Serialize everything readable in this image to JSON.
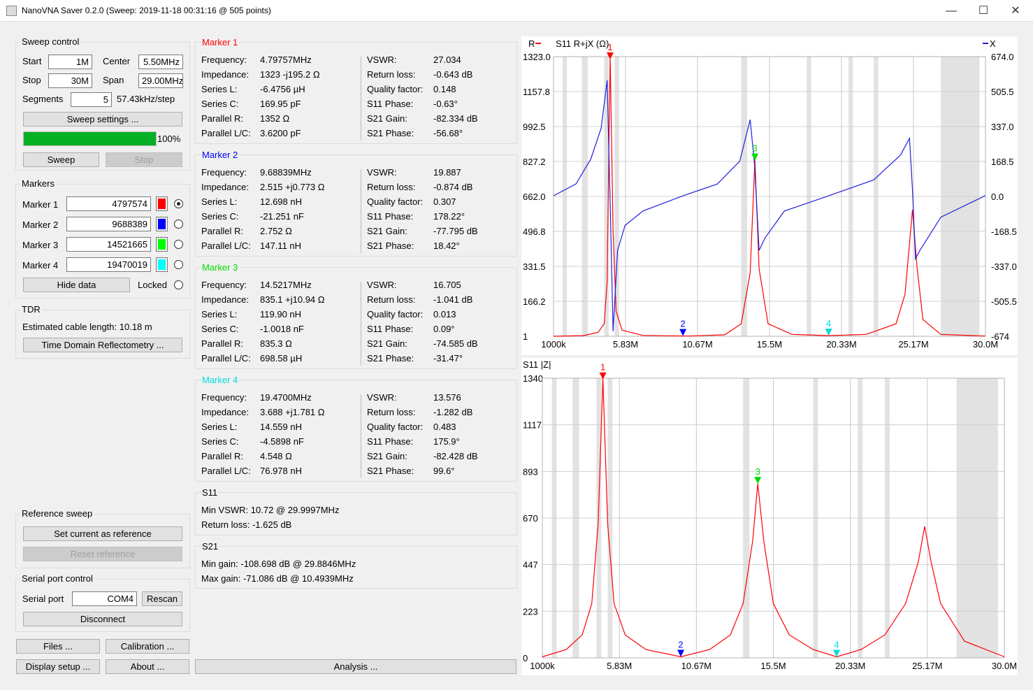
{
  "window": {
    "title": "NanoVNA Saver 0.2.0 (Sweep: 2019-11-18 00:31:16 @ 505 points)",
    "minimize": "—",
    "maximize": "☐",
    "close": "✕"
  },
  "sweep_control": {
    "title": "Sweep control",
    "start_label": "Start",
    "start_value": "1M",
    "center_label": "Center",
    "center_value": "5.50MHz",
    "stop_label": "Stop",
    "stop_value": "30M",
    "span_label": "Span",
    "span_value": "29.00MHz",
    "segments_label": "Segments",
    "segments_value": "5",
    "step_text": "57.43kHz/step",
    "sweep_settings": "Sweep settings ...",
    "progress_text": "100%",
    "progress": 1.0,
    "sweep": "Sweep",
    "stop": "Stop"
  },
  "markers_group": {
    "title": "Markers",
    "items": [
      {
        "label": "Marker 1",
        "value": "4797574",
        "color": "#ff0000",
        "selected": true
      },
      {
        "label": "Marker 2",
        "value": "9688389",
        "color": "#0000ff",
        "selected": false
      },
      {
        "label": "Marker 3",
        "value": "14521665",
        "color": "#00ff00",
        "selected": false
      },
      {
        "label": "Marker 4",
        "value": "19470019",
        "color": "#00ffff",
        "selected": false
      }
    ],
    "hide_data": "Hide data",
    "locked": "Locked"
  },
  "tdr": {
    "title": "TDR",
    "cable_text": "Estimated cable length: 10.18 m",
    "button": "Time Domain Reflectometry ..."
  },
  "reference": {
    "title": "Reference sweep",
    "set": "Set current as reference",
    "reset": "Reset reference"
  },
  "serial": {
    "title": "Serial port control",
    "port_label": "Serial port",
    "port_value": "COM4",
    "rescan": "Rescan",
    "disconnect": "Disconnect"
  },
  "bottom_buttons": {
    "files": "Files ...",
    "calibration": "Calibration ...",
    "display": "Display setup ...",
    "about": "About ...",
    "analysis": "Analysis ..."
  },
  "marker_panels": [
    {
      "title": "Marker 1",
      "color": "#ff0000",
      "left": [
        [
          "Frequency:",
          "4.79757MHz"
        ],
        [
          "Impedance:",
          "1323 -j195.2 Ω"
        ],
        [
          "Series L:",
          "-6.4756 µH"
        ],
        [
          "Series C:",
          "169.95 pF"
        ],
        [
          "Parallel R:",
          "1352 Ω"
        ],
        [
          "Parallel L/C:",
          "3.6200 pF"
        ]
      ],
      "right": [
        [
          "VSWR:",
          "27.034"
        ],
        [
          "Return loss:",
          "-0.643 dB"
        ],
        [
          "Quality factor:",
          "0.148"
        ],
        [
          "S11 Phase:",
          "-0.63°"
        ],
        [
          "S21 Gain:",
          "-82.334 dB"
        ],
        [
          "S21 Phase:",
          "-56.68°"
        ]
      ]
    },
    {
      "title": "Marker 2",
      "color": "#0000ff",
      "left": [
        [
          "Frequency:",
          "9.68839MHz"
        ],
        [
          "Impedance:",
          "2.515 +j0.773 Ω"
        ],
        [
          "Series L:",
          "12.698 nH"
        ],
        [
          "Series C:",
          "-21.251 nF"
        ],
        [
          "Parallel R:",
          "2.752 Ω"
        ],
        [
          "Parallel L/C:",
          "147.11 nH"
        ]
      ],
      "right": [
        [
          "VSWR:",
          "19.887"
        ],
        [
          "Return loss:",
          "-0.874 dB"
        ],
        [
          "Quality factor:",
          "0.307"
        ],
        [
          "S11 Phase:",
          "178.22°"
        ],
        [
          "S21 Gain:",
          "-77.795 dB"
        ],
        [
          "S21 Phase:",
          "18.42°"
        ]
      ]
    },
    {
      "title": "Marker 3",
      "color": "#00dd00",
      "left": [
        [
          "Frequency:",
          "14.5217MHz"
        ],
        [
          "Impedance:",
          "835.1 +j10.94 Ω"
        ],
        [
          "Series L:",
          "119.90 nH"
        ],
        [
          "Series C:",
          "-1.0018 nF"
        ],
        [
          "Parallel R:",
          "835.3 Ω"
        ],
        [
          "Parallel L/C:",
          "698.58 µH"
        ]
      ],
      "right": [
        [
          "VSWR:",
          "16.705"
        ],
        [
          "Return loss:",
          "-1.041 dB"
        ],
        [
          "Quality factor:",
          "0.013"
        ],
        [
          "S11 Phase:",
          "0.09°"
        ],
        [
          "S21 Gain:",
          "-74.585 dB"
        ],
        [
          "S21 Phase:",
          "-31.47°"
        ]
      ]
    },
    {
      "title": "Marker 4",
      "color": "#00dddd",
      "left": [
        [
          "Frequency:",
          "19.4700MHz"
        ],
        [
          "Impedance:",
          "3.688 +j1.781 Ω"
        ],
        [
          "Series L:",
          "14.559 nH"
        ],
        [
          "Series C:",
          "-4.5898 nF"
        ],
        [
          "Parallel R:",
          "4.548 Ω"
        ],
        [
          "Parallel L/C:",
          "76.978 nH"
        ]
      ],
      "right": [
        [
          "VSWR:",
          "13.576"
        ],
        [
          "Return loss:",
          "-1.282 dB"
        ],
        [
          "Quality factor:",
          "0.483"
        ],
        [
          "S11 Phase:",
          "175.9°"
        ],
        [
          "S21 Gain:",
          "-82.428 dB"
        ],
        [
          "S21 Phase:",
          "99.6°"
        ]
      ]
    }
  ],
  "s11_summary": {
    "title": "S11",
    "lines": [
      "Min VSWR:  10.72 @ 29.9997MHz",
      "Return loss: -1.625 dB"
    ]
  },
  "s21_summary": {
    "title": "S21",
    "lines": [
      "Min gain:  -108.698 dB @ 29.8846MHz",
      "Max gain: -71.086 dB @ 10.4939MHz"
    ]
  },
  "chart_data": [
    {
      "type": "line",
      "title": "S11  R+jX (Ω)",
      "legend_left": "R",
      "legend_right": "X",
      "x_ticks": [
        "1000k",
        "5.83M",
        "10.67M",
        "15.5M",
        "20.33M",
        "25.17M",
        "30.0M"
      ],
      "x_range": [
        1.0,
        30.0
      ],
      "y_left_ticks": [
        "1323.0",
        "1157.8",
        "992.5",
        "827.2",
        "662.0",
        "496.8",
        "331.5",
        "166.2",
        "1"
      ],
      "y_left_range": [
        1,
        1323
      ],
      "y_right_ticks": [
        "674.0",
        "505.5",
        "337.0",
        "168.5",
        "0.0",
        "-168.5",
        "-337.0",
        "-505.5",
        "-674"
      ],
      "y_right_range": [
        -674,
        674
      ],
      "series": [
        {
          "name": "R",
          "color": "#ff0000",
          "x": [
            1.0,
            3.0,
            4.0,
            4.4,
            4.6,
            4.8,
            5.0,
            5.2,
            5.6,
            7.0,
            10.0,
            12.5,
            13.6,
            14.2,
            14.52,
            14.8,
            15.4,
            17.0,
            19.47,
            22.0,
            24.0,
            24.6,
            25.1,
            25.4,
            25.8,
            27.0,
            30.0
          ],
          "y": [
            1,
            4,
            20,
            60,
            260,
            1323,
            500,
            120,
            30,
            5,
            2,
            8,
            60,
            300,
            835,
            320,
            60,
            10,
            4,
            10,
            60,
            200,
            600,
            330,
            80,
            10,
            2
          ]
        },
        {
          "name": "X",
          "color": "#2020dd",
          "x": [
            1.0,
            2.5,
            3.5,
            4.2,
            4.6,
            4.8,
            5.0,
            5.3,
            5.8,
            7.0,
            9.69,
            12.0,
            13.5,
            14.2,
            14.5,
            14.8,
            15.2,
            16.5,
            19.47,
            22.5,
            24.3,
            24.9,
            25.1,
            25.3,
            25.6,
            27.0,
            30.0
          ],
          "y": [
            3,
            60,
            180,
            330,
            560,
            -30,
            -650,
            -260,
            -140,
            -70,
            3,
            60,
            170,
            370,
            150,
            -260,
            -200,
            -70,
            3,
            80,
            200,
            280,
            30,
            -300,
            -260,
            -100,
            4
          ]
        }
      ],
      "markers": [
        {
          "label": "1",
          "x": 4.797574,
          "color": "#ff0000"
        },
        {
          "label": "2",
          "x": 9.688389,
          "color": "#0000ff"
        },
        {
          "label": "3",
          "x": 14.521665,
          "color": "#00dd00"
        },
        {
          "label": "4",
          "x": 19.470019,
          "color": "#00dddd"
        }
      ]
    },
    {
      "type": "line",
      "title": "S11  |Z|",
      "x_ticks": [
        "1000k",
        "5.83M",
        "10.67M",
        "15.5M",
        "20.33M",
        "25.17M",
        "30.0M"
      ],
      "x_range": [
        1.0,
        30.0
      ],
      "y_ticks": [
        "1340",
        "1117",
        "893",
        "670",
        "447",
        "223",
        "0"
      ],
      "y_range": [
        0,
        1340
      ],
      "series": [
        {
          "name": "|Z|",
          "color": "#ff0000",
          "x": [
            1.0,
            2.5,
            3.5,
            4.1,
            4.5,
            4.8,
            5.1,
            5.5,
            6.2,
            7.5,
            9.69,
            11.5,
            12.8,
            13.6,
            14.2,
            14.52,
            14.9,
            15.5,
            16.5,
            18.0,
            19.47,
            21.0,
            22.5,
            23.8,
            24.6,
            25.0,
            25.4,
            26.0,
            27.5,
            30.0
          ],
          "y": [
            5,
            40,
            110,
            260,
            640,
            1340,
            640,
            260,
            110,
            40,
            5,
            40,
            110,
            260,
            560,
            835,
            560,
            260,
            110,
            40,
            5,
            40,
            110,
            260,
            460,
            630,
            460,
            260,
            80,
            5
          ]
        }
      ],
      "markers": [
        {
          "label": "1",
          "x": 4.797574,
          "color": "#ff0000"
        },
        {
          "label": "2",
          "x": 9.688389,
          "color": "#0000ff"
        },
        {
          "label": "3",
          "x": 14.521665,
          "color": "#00dd00"
        },
        {
          "label": "4",
          "x": 19.470019,
          "color": "#00dddd"
        }
      ]
    }
  ]
}
